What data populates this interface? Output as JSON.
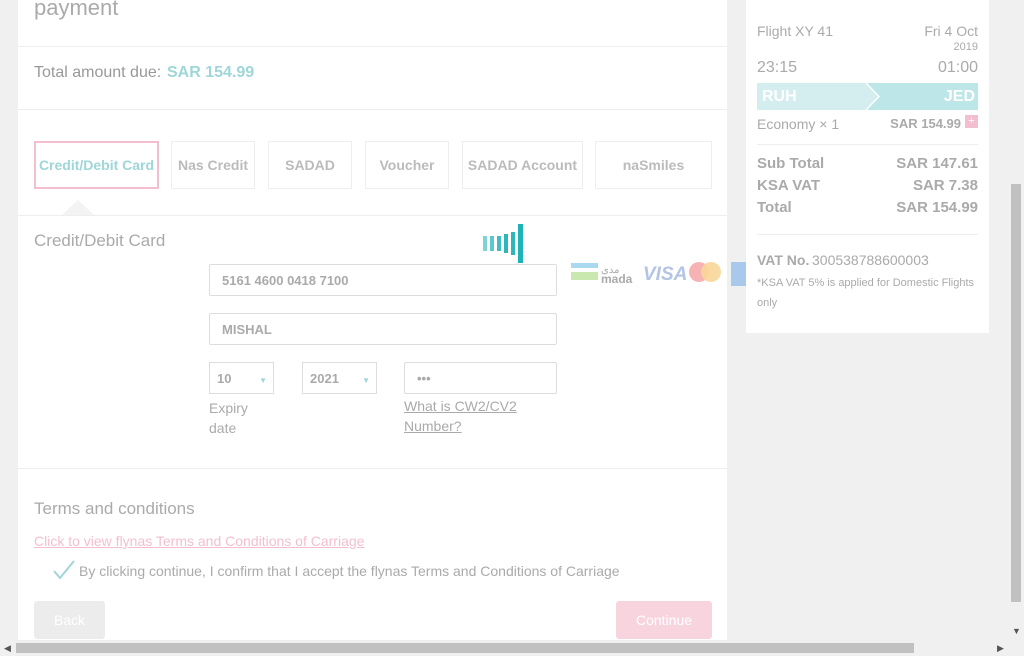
{
  "main": {
    "heading": "payment",
    "total_label": "Total amount due:",
    "total_value": "SAR 154.99",
    "tabs": [
      {
        "label": "Credit/Debit Card",
        "active": true
      },
      {
        "label": "Nas Credit",
        "active": false
      },
      {
        "label": "SADAD",
        "active": false
      },
      {
        "label": "Voucher",
        "active": false
      },
      {
        "label": "SADAD Account",
        "active": false
      },
      {
        "label": "naSmiles",
        "active": false
      }
    ],
    "card_section_title": "Credit/Debit Card",
    "card_number": "5161 4600 0418 7100",
    "card_name": "MISHAL",
    "expiry_month": "10",
    "expiry_year": "2021",
    "cvv": "•••",
    "expiry_label_1": "Expiry",
    "expiry_label_2": "date",
    "cvv_help_1": "What is CW2/CV2",
    "cvv_help_2": "Number?",
    "card_brands": [
      "mada",
      "VISA",
      "mastercard",
      "American Express"
    ],
    "terms_title": "Terms and conditions",
    "terms_link": "Click to view flynas Terms and Conditions of Carriage",
    "terms_checkbox": "By clicking continue, I confirm that I accept the flynas Terms and Conditions of Carriage",
    "back_button": "Back",
    "continue_button": "Continue"
  },
  "summary": {
    "flight": "Flight XY 41",
    "date": "Fri 4 Oct",
    "year": "2019",
    "depart_time": "23:15",
    "arrive_time": "01:00",
    "origin": "RUH",
    "destination": "JED",
    "fare_class": "Economy × 1",
    "fare_price": "SAR 154.99",
    "sub_total_label": "Sub Total",
    "sub_total": "SAR 147.61",
    "vat_label": "KSA VAT",
    "vat": "SAR 7.38",
    "total_label": "Total",
    "total": "SAR 154.99",
    "vat_no_label": "VAT No.",
    "vat_no": "300538788600003",
    "vat_note_1": "*KSA VAT 5% is applied for Domestic Flights",
    "vat_note_2": "only"
  },
  "colors": {
    "accent": "#9fd6d8",
    "pink": "#f3bfd0",
    "spinner": "#1fb3b8"
  }
}
